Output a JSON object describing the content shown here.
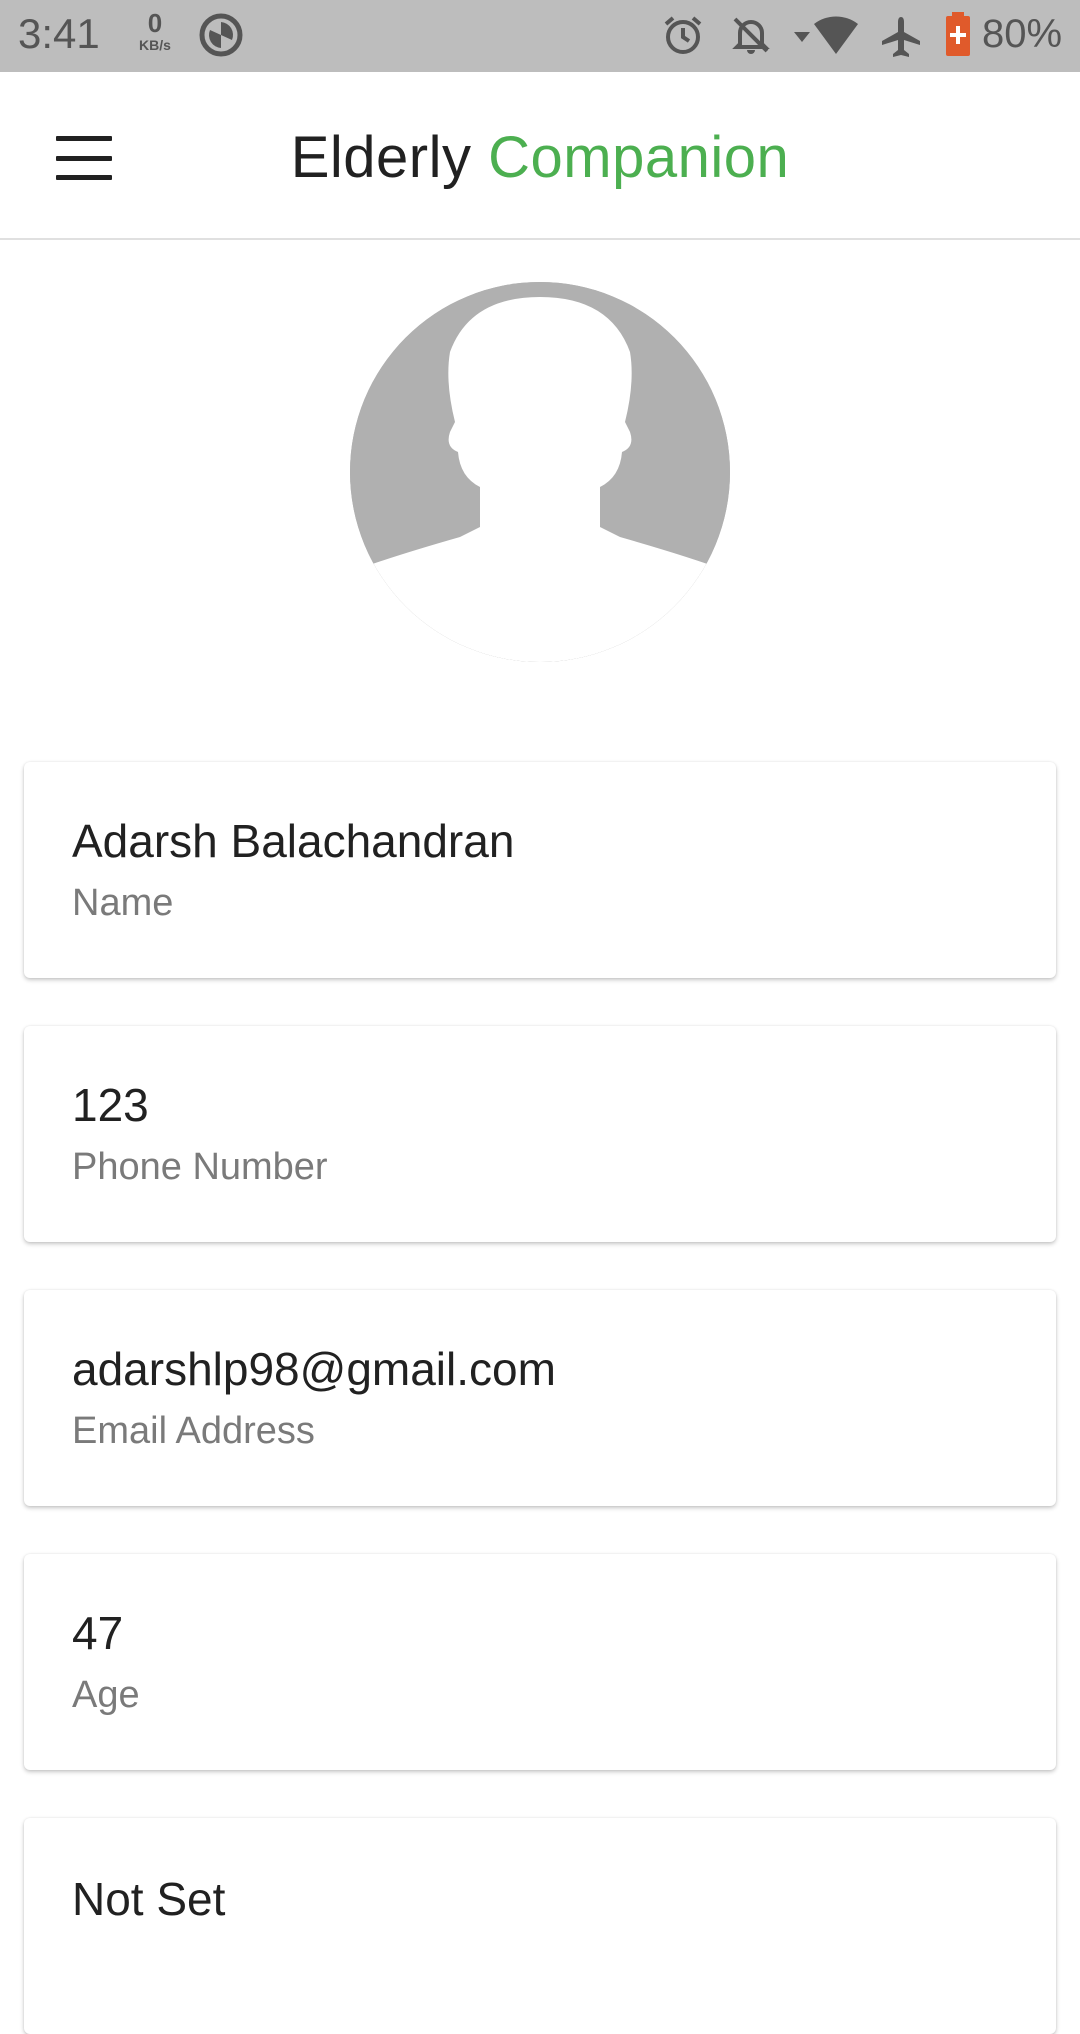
{
  "status_bar": {
    "time": "3:41",
    "net_speed_value": "0",
    "net_speed_unit": "KB/s",
    "battery_percent": "80%",
    "icons": [
      "data-saver-icon",
      "alarm-icon",
      "notifications-off-icon",
      "wifi-icon",
      "airplane-mode-icon",
      "battery-icon"
    ]
  },
  "app_bar": {
    "title_part1": "Elderly",
    "title_part2": "Companion",
    "accent_color": "#4caf50"
  },
  "profile": {
    "avatar_caption": "",
    "fields": [
      {
        "value": "Adarsh Balachandran",
        "label": "Name"
      },
      {
        "value": "123",
        "label": "Phone Number"
      },
      {
        "value": "adarshlp98@gmail.com",
        "label": "Email Address"
      },
      {
        "value": "47",
        "label": "Age"
      },
      {
        "value": "Not Set",
        "label": ""
      }
    ]
  }
}
